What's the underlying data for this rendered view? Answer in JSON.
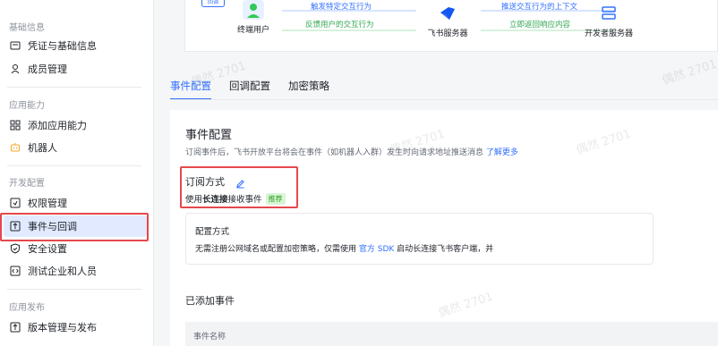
{
  "sidebar": {
    "sections": [
      {
        "title": "基础信息",
        "items": [
          "凭证与基础信息",
          "成员管理"
        ]
      },
      {
        "title": "应用能力",
        "items": [
          "添加应用能力",
          "机器人"
        ]
      },
      {
        "title": "开发配置",
        "items": [
          "权限管理",
          "事件与回调",
          "安全设置",
          "测试企业和人员"
        ]
      },
      {
        "title": "应用发布",
        "items": [
          "版本管理与发布"
        ]
      }
    ],
    "active_item": "事件与回调"
  },
  "flow": {
    "end_user": "终端用户",
    "feishu_server": "飞书服务器",
    "dev_server": "开发者服务器",
    "arrow_trigger": "触发特定交互行为",
    "arrow_feedback": "反馈用户的交互行为",
    "arrow_push": "推送交互行为的上下文",
    "arrow_return": "立即返回响应内容",
    "top_left_label": "回调"
  },
  "tabs": [
    "事件配置",
    "回调配置",
    "加密策略"
  ],
  "active_tab": "事件配置",
  "event_config": {
    "title": "事件配置",
    "desc": "订阅事件后，飞书开放平台将会在事件（如机器人入群）发生时向请求地址推送消息 ",
    "desc_link": "了解更多",
    "sub_title": "订阅方式",
    "sub_line_prefix": "使用 ",
    "sub_line_bold": "长连接",
    "sub_line_suffix": " 接收事件",
    "badge": "推荐",
    "info_title": "配置方式",
    "info_text_prefix": "无需注册公网域名或配置加密策略，仅需使用 ",
    "info_text_link": "官方 SDK",
    "info_text_suffix": " 启动长连接飞书客户端，并",
    "added_title": "已添加事件",
    "table_col_name": "事件名称"
  },
  "watermark": "偶然 2701",
  "colors": {
    "accent": "#3370ff",
    "highlight": "#e5484d",
    "active_bg": "#e1eaff",
    "badge_green": "#2ea121"
  }
}
